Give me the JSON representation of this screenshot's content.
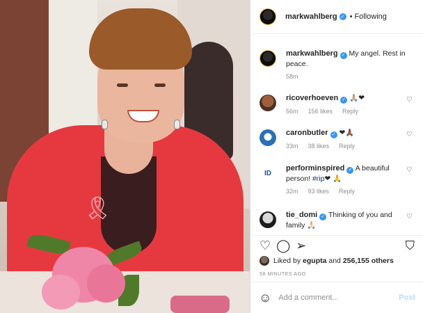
{
  "post": {
    "author": "markwahlberg",
    "follow_status": "Following",
    "dot": "•"
  },
  "comments": [
    {
      "user": "markwahlberg",
      "text": "My angel. Rest in peace.",
      "time": "58m",
      "likes": "",
      "reply": ""
    },
    {
      "user": "ricoverhoeven",
      "text": "🙏🏼❤",
      "time": "56m",
      "likes": "156 likes",
      "reply": "Reply"
    },
    {
      "user": "caronbutler",
      "text": "❤🙏🏾",
      "time": "33m",
      "likes": "38 likes",
      "reply": "Reply"
    },
    {
      "user": "performinspired",
      "text": "A beautiful person! ",
      "hashtag": "#rip",
      "text_after": "❤ 🙏",
      "time": "32m",
      "likes": "93 likes",
      "reply": "Reply"
    },
    {
      "user": "tie_domi",
      "text": "Thinking of you and family 🙏🏻",
      "time": "",
      "likes": "",
      "reply": ""
    }
  ],
  "liked_by": {
    "prefix": "Liked by",
    "user": "egupta",
    "connector": "and",
    "count": "256,155 others"
  },
  "timestamp": "58 MINUTES AGO",
  "add_comment": {
    "placeholder": "Add a comment...",
    "post_label": "Post"
  },
  "icons": {
    "verified": "✓",
    "heart_small": "♡",
    "like": "♡",
    "comment": "◯",
    "share": "➢",
    "save": "⛉",
    "emoji": "☺"
  },
  "colors": {
    "verified": "#3897f0",
    "post_button": "#b2dffc",
    "meta": "#8e8e8e"
  }
}
